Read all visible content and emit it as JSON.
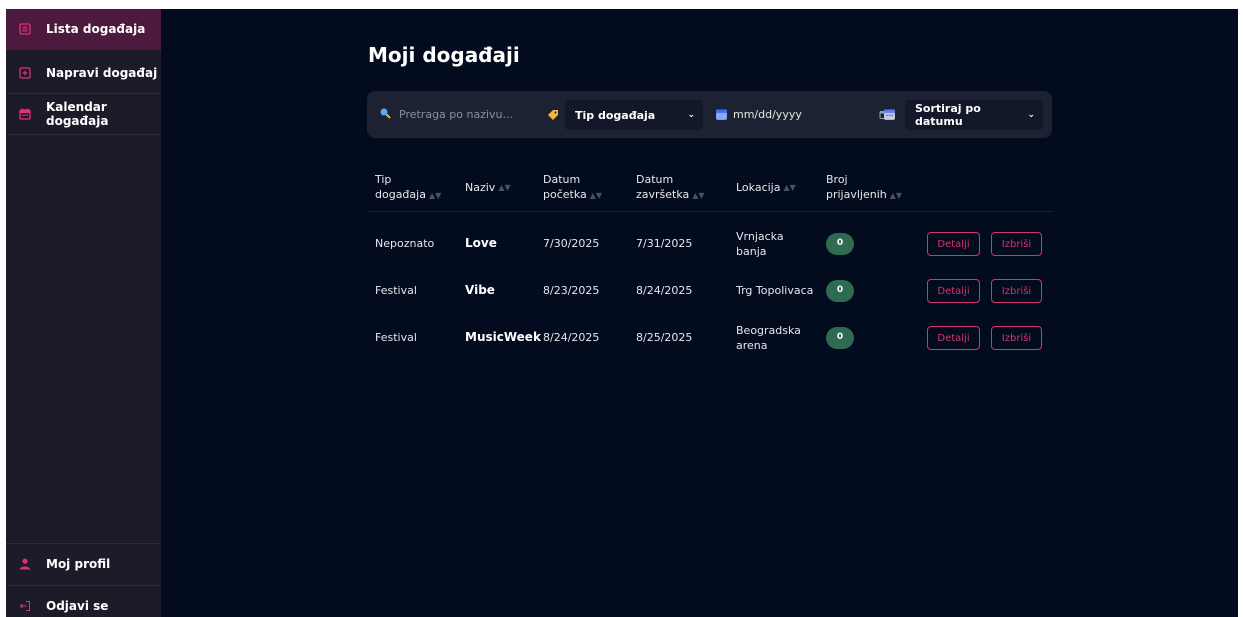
{
  "sidebar": {
    "items": [
      {
        "label": "Lista događaja",
        "icon": "list-icon"
      },
      {
        "label": "Napravi događaj",
        "icon": "plus-square-icon"
      },
      {
        "label": "Kalendar događaja",
        "icon": "calendar-icon"
      }
    ],
    "bottom": [
      {
        "label": "Moj profil",
        "icon": "user-icon"
      },
      {
        "label": "Odjavi se",
        "icon": "logout-icon"
      }
    ]
  },
  "page": {
    "title": "Moji događaji"
  },
  "filters": {
    "search_placeholder": "Pretraga po nazivu...",
    "type_label": "Tip događaja",
    "date_placeholder": "mm/dd/yyyy",
    "sort_label": "Sortiraj po datumu"
  },
  "table": {
    "headers": {
      "type": [
        "Tip",
        "događaja"
      ],
      "name": [
        "Naziv"
      ],
      "start": [
        "Datum",
        "početka"
      ],
      "end": [
        "Datum",
        "završetka"
      ],
      "location": [
        "Lokacija"
      ],
      "count": [
        "Broj",
        "prijavljenih"
      ]
    },
    "rows": [
      {
        "type": "Nepoznato",
        "name": "Love",
        "start": "7/30/2025",
        "end": "7/31/2025",
        "location": "Vrnjacka banja",
        "count": "0"
      },
      {
        "type": "Festival",
        "name": "Vibe",
        "start": "8/23/2025",
        "end": "8/24/2025",
        "location": "Trg Topolivaca",
        "count": "0"
      },
      {
        "type": "Festival",
        "name": "MusicWeek",
        "start": "8/24/2025",
        "end": "8/25/2025",
        "location": "Beogradska arena",
        "count": "0"
      }
    ],
    "details_label": "Detalji",
    "delete_label": "Izbriši"
  },
  "colors": {
    "accent": "#e0307a",
    "badge": "#2e6b52",
    "background": "#030b1e",
    "sidebar": "#1e1b29"
  }
}
